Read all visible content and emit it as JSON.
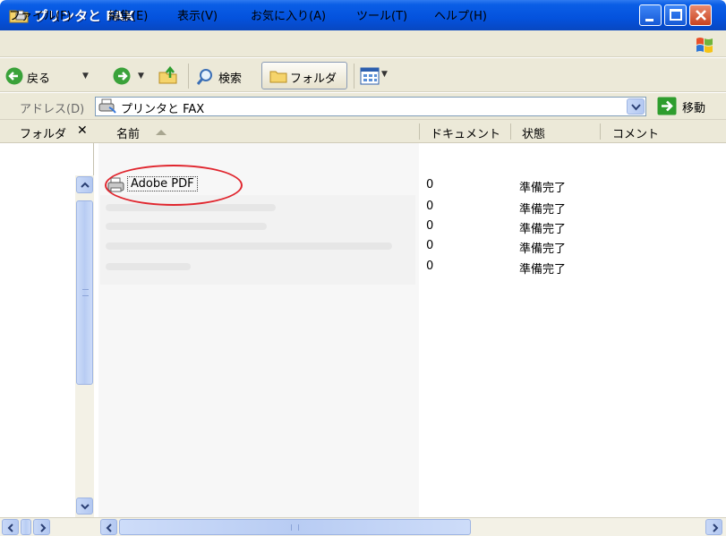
{
  "window": {
    "title": "プリンタと FAX"
  },
  "menu": [
    "ファイル(F)",
    "編集(E)",
    "表示(V)",
    "お気に入り(A)",
    "ツール(T)",
    "ヘルプ(H)"
  ],
  "toolbar": {
    "back_label": "戻る",
    "search_label": "検索",
    "folders_label": "フォルダ"
  },
  "address": {
    "label": "アドレス(D)",
    "value": "プリンタと FAX",
    "go_label": "移動"
  },
  "folder_pane": {
    "title": "フォルダ",
    "close_glyph": "✕"
  },
  "columns": {
    "name": "名前",
    "documents": "ドキュメント",
    "status": "状態",
    "comments": "コメント"
  },
  "printers": [
    {
      "name": "Adobe PDF",
      "documents": "0",
      "status": "準備完了"
    },
    {
      "name": "",
      "documents": "0",
      "status": "準備完了"
    },
    {
      "name": "",
      "documents": "0",
      "status": "準備完了"
    },
    {
      "name": "",
      "documents": "0",
      "status": "準備完了"
    },
    {
      "name": "",
      "documents": "0",
      "status": "準備完了"
    }
  ],
  "icons": [
    "folder-printer-icon",
    "windows-flag-icon",
    "back-arrow-icon",
    "forward-arrow-icon",
    "up-folder-icon",
    "search-icon",
    "folder-icon",
    "view-icon",
    "go-arrow-icon",
    "printer-icon"
  ],
  "colors": {
    "title_bar": "#0452dd",
    "chrome": "#ece9d8",
    "highlight_ring": "#e0262e",
    "go_button": "#2e9d2e"
  }
}
